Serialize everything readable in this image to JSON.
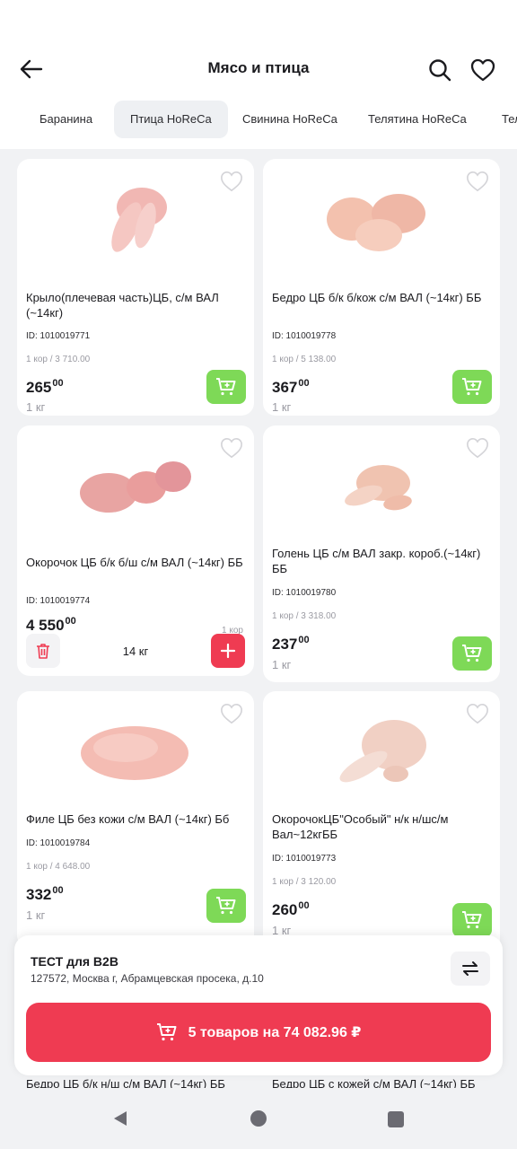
{
  "header": {
    "title": "Мясо и птица",
    "back_icon": "arrow-left-icon",
    "search_icon": "search-icon",
    "favorites_icon": "heart-icon"
  },
  "tabs": [
    {
      "label": "Баранина",
      "active": false
    },
    {
      "label": "Птица HoReCa",
      "active": true
    },
    {
      "label": "Свинина HoReCa",
      "active": false
    },
    {
      "label": "Телятина HoReCa",
      "active": false
    },
    {
      "label": "Тел",
      "active": false
    }
  ],
  "products": [
    {
      "name": "Крыло(плечевая часть)ЦБ, с/м ВАЛ (~14кг)",
      "id": "ID: 1010019771",
      "pack": "1 кор / 3 710.00",
      "price_int": "265",
      "price_frac": "00",
      "unit": "1 кг",
      "state": "cart"
    },
    {
      "name": "Бедро ЦБ б/к б/кож с/м ВАЛ (~14кг) ББ",
      "id": "ID: 1010019778",
      "pack": "1 кор / 5 138.00",
      "price_int": "367",
      "price_frac": "00",
      "unit": "1 кг",
      "state": "cart"
    },
    {
      "name": "Окорочок ЦБ б/к б/ш с/м ВАЛ (~14кг) ББ",
      "id": "ID: 1010019774",
      "pack": "1 кор",
      "price_int": "4 550",
      "price_frac": "00",
      "quantity": "14 кг",
      "state": "in-cart"
    },
    {
      "name": "Голень ЦБ с/м ВАЛ закр. короб.(~14кг) ББ",
      "id": "ID: 1010019780",
      "pack": "1 кор / 3 318.00",
      "price_int": "237",
      "price_frac": "00",
      "unit": "1 кг",
      "state": "cart"
    },
    {
      "name": "Филе ЦБ без кожи с/м ВАЛ (~14кг) Бб",
      "id": "ID: 1010019784",
      "pack": "1 кор / 4 648.00",
      "price_int": "332",
      "price_frac": "00",
      "unit": "1 кг",
      "state": "cart"
    },
    {
      "name": "ОкорочокЦБ\"Особый\" н/к н/шс/м Вал~12кгББ",
      "id": "ID: 1010019773",
      "pack": "1 кор / 3 120.00",
      "price_int": "260",
      "price_frac": "00",
      "unit": "1 кг",
      "state": "cart"
    }
  ],
  "peek_items": [
    "Бедро ЦБ б/к н/ш с/м ВАЛ (~14кг) ББ",
    "Бедро ЦБ с кожей с/м ВАЛ (~14кг) ББ"
  ],
  "bottom": {
    "shop_name": "ТЕСТ для B2B",
    "shop_address": "127572, Москва г, Абрамцевская просека, д.10",
    "checkout_label": "5 товаров на 74 082.96 ₽"
  },
  "colors": {
    "accent_green": "#7ed957",
    "accent_red": "#ef3b52",
    "background": "#f1f2f4"
  }
}
